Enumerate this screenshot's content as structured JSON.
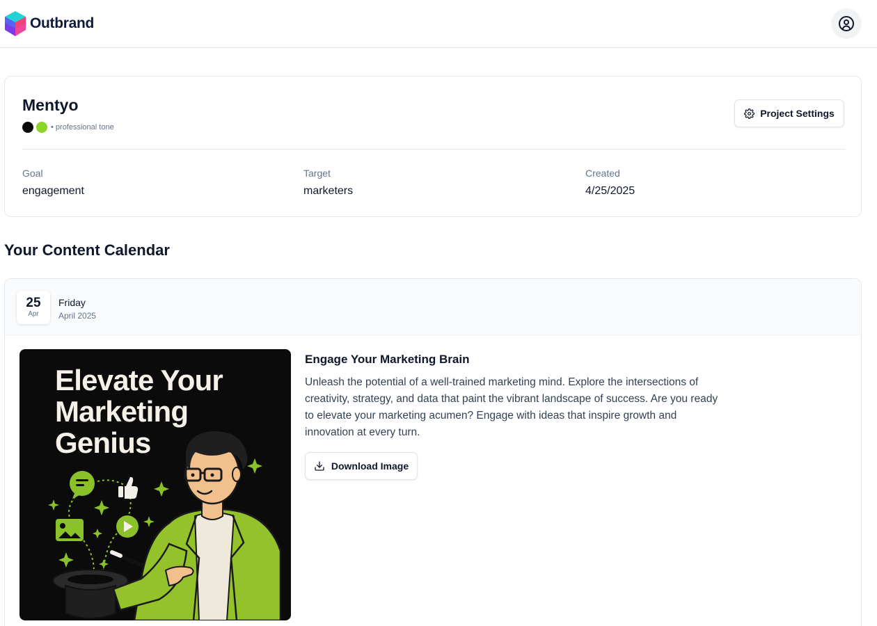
{
  "header": {
    "brand_name": "Outbrand",
    "logo_icon": "cube-logo-icon",
    "account_icon": "user-circle-icon"
  },
  "project": {
    "name": "Mentyo",
    "colors": [
      "#0a0a0a",
      "#8bd42a"
    ],
    "tone": "• professional tone",
    "settings_label": "Project Settings",
    "settings_icon": "gear-icon",
    "goal": {
      "label": "Goal",
      "value": "engagement"
    },
    "target": {
      "label": "Target",
      "value": "marketers"
    },
    "created": {
      "label": "Created",
      "value": "4/25/2025"
    }
  },
  "calendar": {
    "title": "Your Content Calendar",
    "entries": [
      {
        "day": "25",
        "month_short": "Apr",
        "weekday": "Friday",
        "month_year": "April 2025",
        "image": {
          "headline": [
            "Elevate Your",
            "Marketing",
            "Genius"
          ],
          "accent_color": "#8bc22a"
        },
        "post_title": "Engage Your Marketing Brain",
        "post_body": "Unleash the potential of a well-trained marketing mind. Explore the intersections of creativity, strategy, and data that paint the vibrant landscape of success. Are you ready to elevate your marketing acumen? Engage with ideas that inspire growth and innovation at every turn.",
        "download_label": "Download Image",
        "download_icon": "download-icon"
      }
    ]
  }
}
